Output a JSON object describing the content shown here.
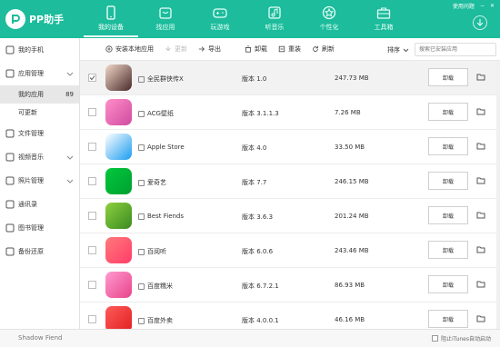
{
  "app": {
    "name": "PP助手"
  },
  "top_right": {
    "feedback": "使用问题",
    "min": "−",
    "close": "✕"
  },
  "nav": [
    {
      "label": "我的设备",
      "icon": "phone-icon",
      "active": true
    },
    {
      "label": "找应用",
      "icon": "bag-icon",
      "active": false
    },
    {
      "label": "玩游戏",
      "icon": "gamepad-icon",
      "active": false
    },
    {
      "label": "听音乐",
      "icon": "music-icon",
      "active": false
    },
    {
      "label": "个性化",
      "icon": "star-icon",
      "active": false
    },
    {
      "label": "工具箱",
      "icon": "toolbox-icon",
      "active": false
    }
  ],
  "sidebar": {
    "items": [
      {
        "label": "我的手机",
        "icon": "phone-icon"
      },
      {
        "label": "应用管理",
        "icon": "apps-icon"
      },
      {
        "label": "我的应用",
        "count": "89"
      },
      {
        "label": "可更新"
      },
      {
        "label": "文件管理",
        "icon": "folder-icon"
      },
      {
        "label": "视频音乐",
        "icon": "video-icon"
      },
      {
        "label": "照片管理",
        "icon": "photo-icon"
      },
      {
        "label": "通讯录",
        "icon": "contacts-icon"
      },
      {
        "label": "图书管理",
        "icon": "book-icon"
      },
      {
        "label": "备份还原",
        "icon": "backup-icon"
      }
    ]
  },
  "toolbar": {
    "install": "安装本地应用",
    "update": "更新",
    "export": "导出",
    "uninstall": "卸载",
    "reinstall": "重装",
    "refresh": "刷新",
    "sort": "排序",
    "search_placeholder": "搜索已安装应用"
  },
  "apps": [
    {
      "name": "全民群侠传X",
      "version": "版本 1.0",
      "size": "247.73 MB",
      "selected": true,
      "color1": "#f0d8c8",
      "color2": "#4a2a2a"
    },
    {
      "name": "ACG壁纸",
      "version": "版本 3.1.1.3",
      "size": "7.26 MB",
      "selected": false,
      "color1": "#ff8fc8",
      "color2": "#d04aa0"
    },
    {
      "name": "Apple Store",
      "version": "版本 4.0",
      "size": "33.50 MB",
      "selected": false,
      "color1": "#ffffff",
      "color2": "#1a9cf0"
    },
    {
      "name": "爱奇艺",
      "version": "版本 7.7",
      "size": "246.15 MB",
      "selected": false,
      "color1": "#00c83c",
      "color2": "#00a030"
    },
    {
      "name": "Best Fiends",
      "version": "版本 3.6.3",
      "size": "201.24 MB",
      "selected": false,
      "color1": "#8ed040",
      "color2": "#3a8a20"
    },
    {
      "name": "百阅听",
      "version": "版本 6.0.6",
      "size": "243.46 MB",
      "selected": false,
      "color1": "#ff7a7a",
      "color2": "#ff3c6a"
    },
    {
      "name": "百度糯米",
      "version": "版本 6.7.2.1",
      "size": "86.93 MB",
      "selected": false,
      "color1": "#ff9ad0",
      "color2": "#e8448a"
    },
    {
      "name": "百度外卖",
      "version": "版本 4.0.0.1",
      "size": "46.16 MB",
      "selected": false,
      "color1": "#ff5a5a",
      "color2": "#e02020"
    }
  ],
  "row_action": "卸载",
  "status": {
    "device": "Shadow Fiend",
    "itunes": "阻止iTunes自动启动"
  },
  "colors": {
    "accent": "#1cbc9c"
  }
}
